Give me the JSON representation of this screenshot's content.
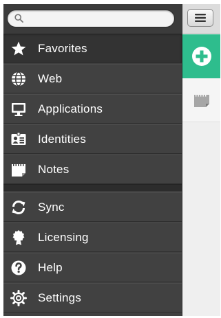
{
  "search": {
    "placeholder": "",
    "icon": "search-icon"
  },
  "menu": {
    "items": [
      {
        "label": "Favorites",
        "icon": "star-icon",
        "selected": true
      },
      {
        "label": "Web",
        "icon": "globe-icon"
      },
      {
        "label": "Applications",
        "icon": "monitor-icon"
      },
      {
        "label": "Identities",
        "icon": "id-card-icon"
      },
      {
        "label": "Notes",
        "icon": "note-icon"
      }
    ],
    "bottom_items": [
      {
        "label": "Sync",
        "icon": "sync-icon"
      },
      {
        "label": "Licensing",
        "icon": "award-ribbon-icon"
      },
      {
        "label": "Help",
        "icon": "help-icon"
      },
      {
        "label": "Settings",
        "icon": "gear-icon"
      }
    ]
  },
  "right_panel": {
    "menu_button_icon": "hamburger-icon",
    "add_button_icon": "plus-circle-icon",
    "tab_icon": "note-icon"
  },
  "colors": {
    "drawer_bg": "#404040",
    "selected_bg": "#333333",
    "accent_green": "#2ebd8d",
    "text": "#ffffff"
  }
}
